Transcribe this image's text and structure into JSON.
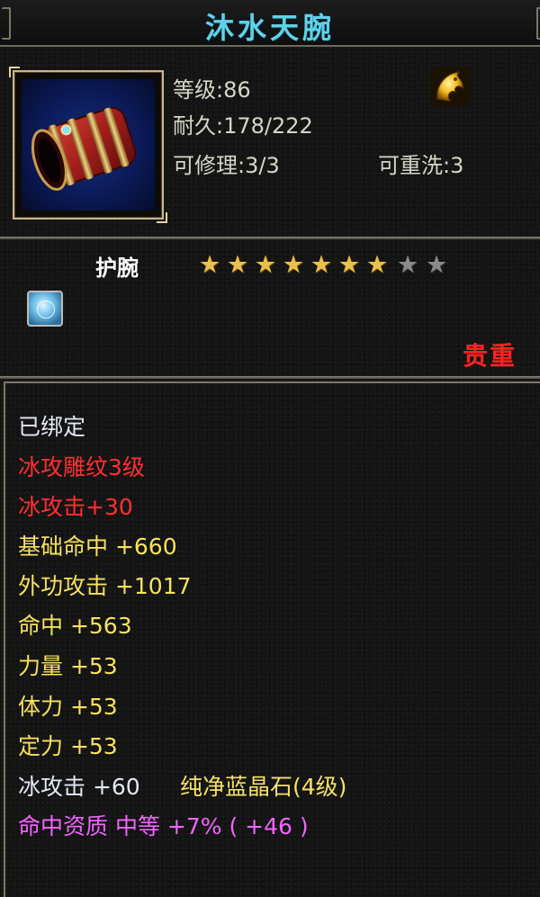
{
  "tooltip": {
    "title": "沐水天腕",
    "level": "等级:86",
    "durability": "耐久:178/222",
    "repairable": "可修理:3/3",
    "rewashable": "可重洗:3",
    "type": "护腕",
    "stars_total": 9,
    "stars_lit": 7,
    "rarity": "贵重",
    "colors": {
      "title": "#5fd2ea",
      "rarity": "#ff2222",
      "bound": "#e3e8f4",
      "red_attr": "#ff3030",
      "yellow_attr": "#f6e25c",
      "pink_attr": "#f264ff"
    },
    "icons": {
      "item": "red-bracer-icon",
      "gold": "gold-dragon-icon",
      "gem": "ice-gem-icon",
      "star": "star-icon"
    }
  },
  "attributes": {
    "bound": "已绑定",
    "engrave": "冰攻雕纹3级",
    "ice_attack_engrave": "冰攻击+30",
    "base_hit": "基础命中  +660",
    "outer_attack": "外功攻击  +1017",
    "hit": "命中  +563",
    "strength": "力量  +53",
    "stamina": "体力  +53",
    "focus": "定力  +53",
    "gem_attr_value": "冰攻击  +60",
    "gem_name": "纯净蓝晶石(4级)",
    "hit_quality": "命中资质    中等  +7%  ( +46 )"
  }
}
